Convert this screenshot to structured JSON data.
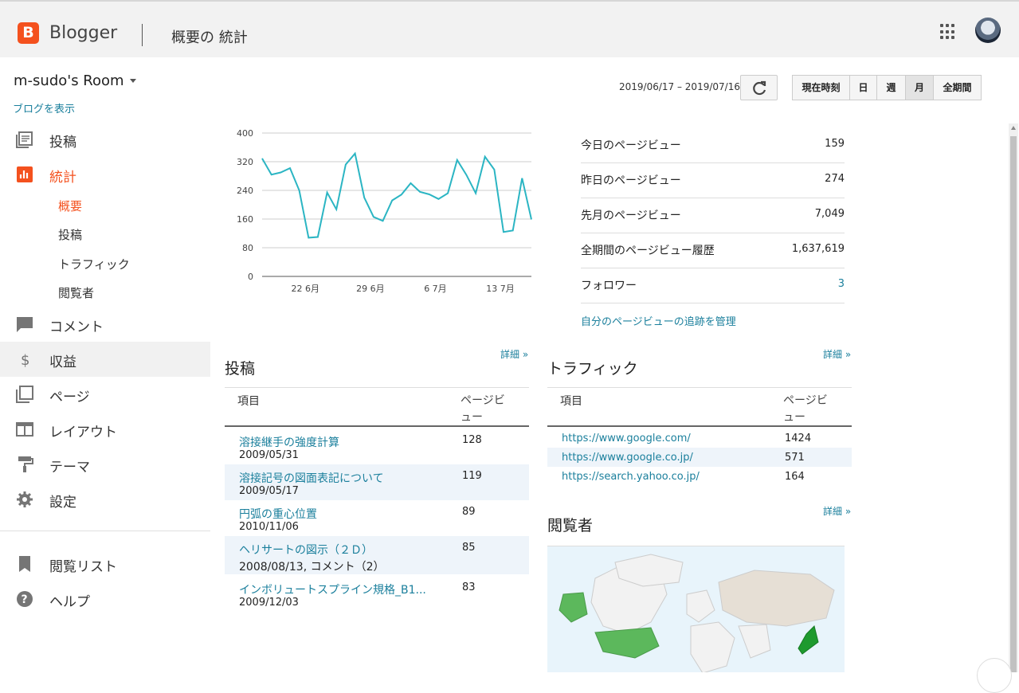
{
  "header": {
    "logo_letter": "B",
    "brand": "Blogger",
    "page_title": "概要の 統計",
    "apps_icon": "apps-grid-icon",
    "avatar_icon": "account-avatar"
  },
  "sidebar": {
    "blog_name": "m-sudo's Room",
    "view_blog": "ブログを表示",
    "items": [
      {
        "label": "投稿",
        "icon": "posts-icon"
      },
      {
        "label": "統計",
        "icon": "stats-icon"
      },
      {
        "label": "コメント",
        "icon": "comment-icon"
      },
      {
        "label": "収益",
        "icon": "dollar-icon"
      },
      {
        "label": "ページ",
        "icon": "pages-icon"
      },
      {
        "label": "レイアウト",
        "icon": "layout-icon"
      },
      {
        "label": "テーマ",
        "icon": "paint-roller-icon"
      },
      {
        "label": "設定",
        "icon": "gear-icon"
      },
      {
        "label": "閲覧リスト",
        "icon": "bookmark-icon"
      },
      {
        "label": "ヘルプ",
        "icon": "help-icon"
      }
    ],
    "subitems": [
      "概要",
      "投稿",
      "トラフィック",
      "閲覧者"
    ]
  },
  "toolbar": {
    "date_range": "2019/06/17 – 2019/07/16",
    "refresh_icon": "refresh-icon",
    "ranges": [
      "現在時刻",
      "日",
      "週",
      "月",
      "全期間"
    ],
    "selected_range": "月"
  },
  "chart_data": {
    "type": "line",
    "x_tick_labels": [
      "22 6月",
      "29 6月",
      "6 7月",
      "13 7月"
    ],
    "y_ticks": [
      0,
      80,
      160,
      240,
      320,
      400
    ],
    "ylim": [
      0,
      400
    ],
    "x": [
      "2019/06/17",
      "2019/06/18",
      "2019/06/19",
      "2019/06/20",
      "2019/06/21",
      "2019/06/22",
      "2019/06/23",
      "2019/06/24",
      "2019/06/25",
      "2019/06/26",
      "2019/06/27",
      "2019/06/28",
      "2019/06/29",
      "2019/06/30",
      "2019/07/01",
      "2019/07/02",
      "2019/07/03",
      "2019/07/04",
      "2019/07/05",
      "2019/07/06",
      "2019/07/07",
      "2019/07/08",
      "2019/07/09",
      "2019/07/10",
      "2019/07/11",
      "2019/07/12",
      "2019/07/13",
      "2019/07/14",
      "2019/07/15",
      "2019/07/16"
    ],
    "values": [
      329,
      284,
      290,
      302,
      240,
      108,
      110,
      234,
      187,
      312,
      343,
      220,
      166,
      155,
      212,
      228,
      260,
      236,
      229,
      216,
      232,
      325,
      283,
      232,
      334,
      298,
      124,
      128,
      274,
      159
    ],
    "color": "#2bb5c3",
    "grid": true
  },
  "summary": [
    {
      "label": "今日のページビュー",
      "value": "159"
    },
    {
      "label": "昨日のページビュー",
      "value": "274"
    },
    {
      "label": "先月のページビュー",
      "value": "7,049"
    },
    {
      "label": "全期間のページビュー履歴",
      "value": "1,637,619"
    },
    {
      "label": "フォロワー",
      "value": "3"
    }
  ],
  "manage_link": "自分のページビューの追跡を管理",
  "posts": {
    "title": "投稿",
    "detail": "詳細 »",
    "col_item": "項目",
    "col_views": "ページビュー",
    "rows": [
      {
        "title": "溶接継手の強度計算",
        "date": "2009/05/31",
        "views": "128"
      },
      {
        "title": "溶接記号の図面表記について",
        "date": "2009/05/17",
        "views": "119"
      },
      {
        "title": "円弧の重心位置",
        "date": "2010/11/06",
        "views": "89"
      },
      {
        "title": "ヘリサートの図示（２Ｄ）",
        "date": "2008/08/13, コメント（2）",
        "views": "85"
      },
      {
        "title": "インボリュートスプライン規格_B1...",
        "date": "2009/12/03",
        "views": "83"
      }
    ]
  },
  "traffic": {
    "title": "トラフィック",
    "detail": "詳細 »",
    "col_item": "項目",
    "col_views": "ページビュー",
    "rows": [
      {
        "source": "https://www.google.com/",
        "views": "1424"
      },
      {
        "source": "https://www.google.co.jp/",
        "views": "571"
      },
      {
        "source": "https://search.yahoo.co.jp/",
        "views": "164"
      }
    ]
  },
  "audience": {
    "title": "閲覧者",
    "detail": "詳細 »",
    "map_icon": "world-map",
    "colors": {
      "ocean": "#e8f4fb",
      "land": "#f2f2f2",
      "shaded": "#e6dfd5",
      "active": "#5cb85c",
      "strong": "#1e9a2e"
    }
  }
}
